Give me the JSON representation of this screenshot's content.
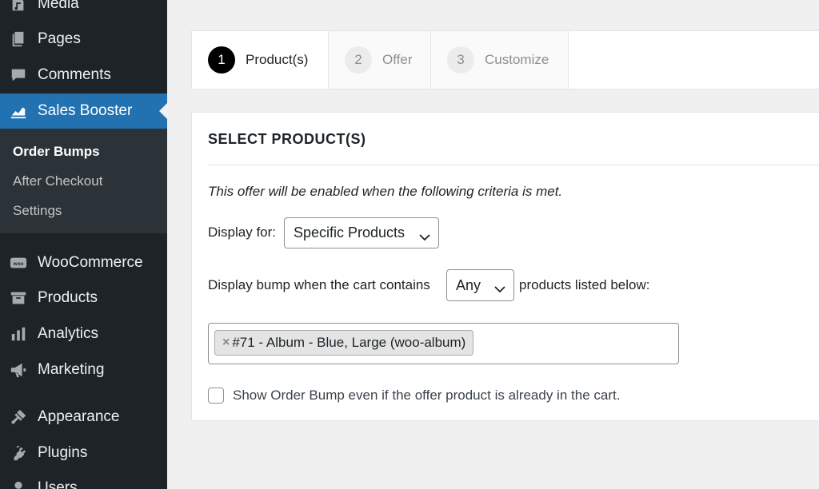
{
  "sidebar": {
    "items": [
      {
        "label": "Media",
        "icon": "media-icon"
      },
      {
        "label": "Pages",
        "icon": "pages-icon"
      },
      {
        "label": "Comments",
        "icon": "comments-icon"
      },
      {
        "label": "Sales Booster",
        "icon": "sales-booster-icon",
        "active": true
      },
      {
        "label": "WooCommerce",
        "icon": "woocommerce-icon"
      },
      {
        "label": "Products",
        "icon": "products-icon"
      },
      {
        "label": "Analytics",
        "icon": "analytics-icon"
      },
      {
        "label": "Marketing",
        "icon": "marketing-icon"
      },
      {
        "label": "Appearance",
        "icon": "appearance-icon"
      },
      {
        "label": "Plugins",
        "icon": "plugins-icon"
      },
      {
        "label": "Users",
        "icon": "users-icon"
      }
    ],
    "submenu": [
      {
        "label": "Order Bumps",
        "current": true
      },
      {
        "label": "After Checkout"
      },
      {
        "label": "Settings"
      }
    ]
  },
  "steps": [
    {
      "num": "1",
      "label": "Product(s)",
      "current": true
    },
    {
      "num": "2",
      "label": "Offer"
    },
    {
      "num": "3",
      "label": "Customize"
    }
  ],
  "card": {
    "title": "SELECT PRODUCT(S)",
    "criteria_text": "This offer will be enabled when the following criteria is met.",
    "display_for_label": "Display for:",
    "display_for_value": "Specific Products",
    "contains_label": "Display bump when the cart contains",
    "contains_value": "Any",
    "listed_label": "products listed below:",
    "tag_remove": "×",
    "selected_product": "#71 - Album - Blue, Large (woo-album)",
    "checkbox_label": "Show Order Bump even if the offer product is already in the cart.",
    "checkbox_checked": false
  },
  "colors": {
    "sidebar_bg": "#1d2327",
    "submenu_bg": "#2c3338",
    "accent": "#2271b1",
    "page_bg": "#f0f0f1"
  }
}
